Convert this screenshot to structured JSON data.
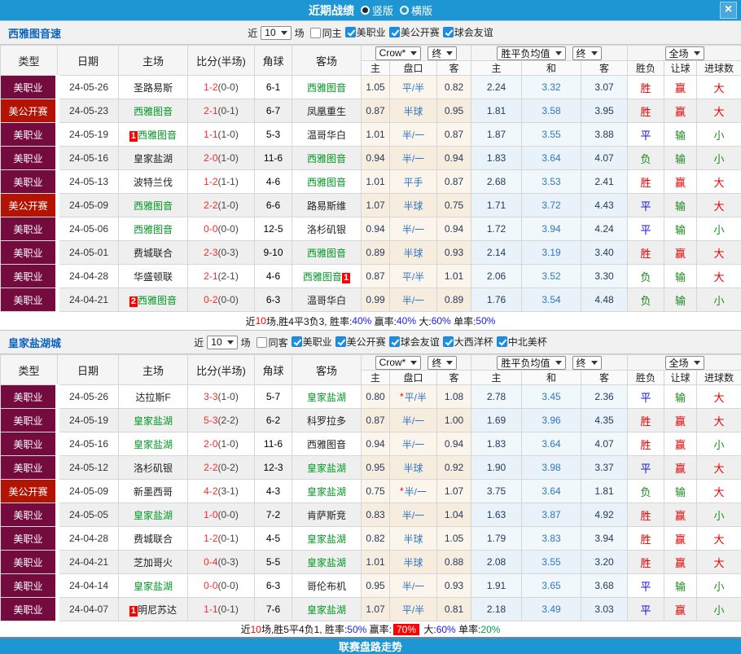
{
  "top_bar": {
    "title": "近期战绩",
    "radio_selected_label": "竖版",
    "radio_unselected_label": "横版",
    "close_glyph": "×"
  },
  "bottom_bar": {
    "label": "联赛盘路走势"
  },
  "colors": {
    "bar_blue": "#1E96D3",
    "league_mls": "#740B3F",
    "league_open_cup": "#B21303",
    "team_highlight_green": "#009922",
    "score_red": "#FF2A2A",
    "win_red": "#E60000",
    "draw_blue": "#1515D0",
    "loss_green": "#1E8A1E"
  },
  "table_header": {
    "cols": [
      "类型",
      "日期",
      "主场",
      "比分(半场)",
      "角球",
      "客场"
    ],
    "crow_select": "Crow*",
    "crow_final": "终",
    "avg_select": "胜平负均值",
    "avg_final": "终",
    "scope_select": "全场",
    "sub": [
      "主",
      "盘口",
      "客",
      "主",
      "和",
      "客",
      "胜负",
      "让球",
      "进球数"
    ]
  },
  "sections": [
    {
      "team": "西雅图音速",
      "filter": {
        "near": "近",
        "count": "10",
        "unit": "场",
        "same_label": "同主",
        "same_checked": false,
        "leagues": [
          {
            "label": "美职业",
            "checked": true
          },
          {
            "label": "美公开赛",
            "checked": true
          },
          {
            "label": "球会友谊",
            "checked": true
          }
        ]
      },
      "rows": [
        {
          "lg": "美职业",
          "lgc": "lg-mls",
          "date": "24-05-26",
          "home": "圣路易斯",
          "hg": false,
          "hb": "",
          "hbp": "",
          "score": "1-2",
          "half": "(0-0)",
          "corner": "6-1",
          "away": "西雅图音",
          "ag": true,
          "ab": "",
          "abp": "",
          "o1": "1.05",
          "hd": "平/半",
          "star": false,
          "o2": "0.82",
          "a1": "2.24",
          "a2": "3.32",
          "a3": "3.07",
          "r1": "胜",
          "r1c": "red",
          "r2": "赢",
          "r2c": "red",
          "r3": "大",
          "r3c": "red"
        },
        {
          "lg": "美公开赛",
          "lgc": "lg-open",
          "date": "24-05-23",
          "home": "西雅图音",
          "hg": true,
          "hb": "",
          "hbp": "",
          "score": "2-1",
          "half": "(0-1)",
          "corner": "6-7",
          "away": "凤凰重生",
          "ag": false,
          "ab": "",
          "abp": "",
          "o1": "0.87",
          "hd": "半球",
          "star": false,
          "o2": "0.95",
          "a1": "1.81",
          "a2": "3.58",
          "a3": "3.95",
          "r1": "胜",
          "r1c": "red",
          "r2": "赢",
          "r2c": "red",
          "r3": "大",
          "r3c": "red"
        },
        {
          "lg": "美职业",
          "lgc": "lg-mls",
          "date": "24-05-19",
          "home": "西雅图音",
          "hg": true,
          "hb": "1",
          "hbp": "before",
          "score": "1-1",
          "half": "(1-0)",
          "corner": "5-3",
          "away": "温哥华白",
          "ag": false,
          "ab": "",
          "abp": "",
          "o1": "1.01",
          "hd": "半/一",
          "star": false,
          "o2": "0.87",
          "a1": "1.87",
          "a2": "3.55",
          "a3": "3.88",
          "r1": "平",
          "r1c": "blue",
          "r2": "输",
          "r2c": "green",
          "r3": "小",
          "r3c": "green"
        },
        {
          "lg": "美职业",
          "lgc": "lg-mls",
          "date": "24-05-16",
          "home": "皇家盐湖",
          "hg": false,
          "hb": "",
          "hbp": "",
          "score": "2-0",
          "half": "(1-0)",
          "corner": "11-6",
          "away": "西雅图音",
          "ag": true,
          "ab": "",
          "abp": "",
          "o1": "0.94",
          "hd": "半/一",
          "star": false,
          "o2": "0.94",
          "a1": "1.83",
          "a2": "3.64",
          "a3": "4.07",
          "r1": "负",
          "r1c": "green",
          "r2": "输",
          "r2c": "green",
          "r3": "小",
          "r3c": "green"
        },
        {
          "lg": "美职业",
          "lgc": "lg-mls",
          "date": "24-05-13",
          "home": "波特兰伐",
          "hg": false,
          "hb": "",
          "hbp": "",
          "score": "1-2",
          "half": "(1-1)",
          "corner": "4-6",
          "away": "西雅图音",
          "ag": true,
          "ab": "",
          "abp": "",
          "o1": "1.01",
          "hd": "平手",
          "star": false,
          "o2": "0.87",
          "a1": "2.68",
          "a2": "3.53",
          "a3": "2.41",
          "r1": "胜",
          "r1c": "red",
          "r2": "赢",
          "r2c": "red",
          "r3": "大",
          "r3c": "red"
        },
        {
          "lg": "美公开赛",
          "lgc": "lg-open",
          "date": "24-05-09",
          "home": "西雅图音",
          "hg": true,
          "hb": "",
          "hbp": "",
          "score": "2-2",
          "half": "(1-0)",
          "corner": "6-6",
          "away": "路易斯维",
          "ag": false,
          "ab": "",
          "abp": "",
          "o1": "1.07",
          "hd": "半球",
          "star": false,
          "o2": "0.75",
          "a1": "1.71",
          "a2": "3.72",
          "a3": "4.43",
          "r1": "平",
          "r1c": "blue",
          "r2": "输",
          "r2c": "green",
          "r3": "大",
          "r3c": "red"
        },
        {
          "lg": "美职业",
          "lgc": "lg-mls",
          "date": "24-05-06",
          "home": "西雅图音",
          "hg": true,
          "hb": "",
          "hbp": "",
          "score": "0-0",
          "half": "(0-0)",
          "corner": "12-5",
          "away": "洛杉矶银",
          "ag": false,
          "ab": "",
          "abp": "",
          "o1": "0.94",
          "hd": "半/一",
          "star": false,
          "o2": "0.94",
          "a1": "1.72",
          "a2": "3.94",
          "a3": "4.24",
          "r1": "平",
          "r1c": "blue",
          "r2": "输",
          "r2c": "green",
          "r3": "小",
          "r3c": "green"
        },
        {
          "lg": "美职业",
          "lgc": "lg-mls",
          "date": "24-05-01",
          "home": "费城联合",
          "hg": false,
          "hb": "",
          "hbp": "",
          "score": "2-3",
          "half": "(0-3)",
          "corner": "9-10",
          "away": "西雅图音",
          "ag": true,
          "ab": "",
          "abp": "",
          "o1": "0.89",
          "hd": "半球",
          "star": false,
          "o2": "0.93",
          "a1": "2.14",
          "a2": "3.19",
          "a3": "3.40",
          "r1": "胜",
          "r1c": "red",
          "r2": "赢",
          "r2c": "red",
          "r3": "大",
          "r3c": "red"
        },
        {
          "lg": "美职业",
          "lgc": "lg-mls",
          "date": "24-04-28",
          "home": "华盛顿联",
          "hg": false,
          "hb": "",
          "hbp": "",
          "score": "2-1",
          "half": "(2-1)",
          "corner": "4-6",
          "away": "西雅图音",
          "ag": true,
          "ab": "1",
          "abp": "after",
          "o1": "0.87",
          "hd": "平/半",
          "star": false,
          "o2": "1.01",
          "a1": "2.06",
          "a2": "3.52",
          "a3": "3.30",
          "r1": "负",
          "r1c": "green",
          "r2": "输",
          "r2c": "green",
          "r3": "大",
          "r3c": "red"
        },
        {
          "lg": "美职业",
          "lgc": "lg-mls",
          "date": "24-04-21",
          "home": "西雅图音",
          "hg": true,
          "hb": "2",
          "hbp": "before",
          "score": "0-2",
          "half": "(0-0)",
          "corner": "6-3",
          "away": "温哥华白",
          "ag": false,
          "ab": "",
          "abp": "",
          "o1": "0.99",
          "hd": "半/一",
          "star": false,
          "o2": "0.89",
          "a1": "1.76",
          "a2": "3.54",
          "a3": "4.48",
          "r1": "负",
          "r1c": "green",
          "r2": "输",
          "r2c": "green",
          "r3": "小",
          "r3c": "green"
        }
      ],
      "summary": [
        {
          "t": "近",
          "c": "k"
        },
        {
          "t": "10",
          "c": "r"
        },
        {
          "t": "场,胜4平3负3, 胜率:",
          "c": "k"
        },
        {
          "t": "40%",
          "c": "b"
        },
        {
          "t": " 赢率:",
          "c": "k"
        },
        {
          "t": "40%",
          "c": "b"
        },
        {
          "t": " 大:",
          "c": "k"
        },
        {
          "t": "60%",
          "c": "b"
        },
        {
          "t": " 单率:",
          "c": "k"
        },
        {
          "t": "50%",
          "c": "b"
        }
      ]
    },
    {
      "team": "皇家盐湖城",
      "filter": {
        "near": "近",
        "count": "10",
        "unit": "场",
        "same_label": "同客",
        "same_checked": false,
        "leagues": [
          {
            "label": "美职业",
            "checked": true
          },
          {
            "label": "美公开赛",
            "checked": true
          },
          {
            "label": "球会友谊",
            "checked": true
          },
          {
            "label": "大西洋杯",
            "checked": true
          },
          {
            "label": "中北美杯",
            "checked": true
          }
        ]
      },
      "rows": [
        {
          "lg": "美职业",
          "lgc": "lg-mls",
          "date": "24-05-26",
          "home": "达拉斯F",
          "hg": false,
          "hb": "",
          "hbp": "",
          "score": "3-3",
          "half": "(1-0)",
          "corner": "5-7",
          "away": "皇家盐湖",
          "ag": true,
          "ab": "",
          "abp": "",
          "o1": "0.80",
          "hd": "平/半",
          "star": true,
          "o2": "1.08",
          "a1": "2.78",
          "a2": "3.45",
          "a3": "2.36",
          "r1": "平",
          "r1c": "blue",
          "r2": "输",
          "r2c": "green",
          "r3": "大",
          "r3c": "red"
        },
        {
          "lg": "美职业",
          "lgc": "lg-mls",
          "date": "24-05-19",
          "home": "皇家盐湖",
          "hg": true,
          "hb": "",
          "hbp": "",
          "score": "5-3",
          "half": "(2-2)",
          "corner": "6-2",
          "away": "科罗拉多",
          "ag": false,
          "ab": "",
          "abp": "",
          "o1": "0.87",
          "hd": "半/一",
          "star": false,
          "o2": "1.00",
          "a1": "1.69",
          "a2": "3.96",
          "a3": "4.35",
          "r1": "胜",
          "r1c": "red",
          "r2": "赢",
          "r2c": "red",
          "r3": "大",
          "r3c": "red"
        },
        {
          "lg": "美职业",
          "lgc": "lg-mls",
          "date": "24-05-16",
          "home": "皇家盐湖",
          "hg": true,
          "hb": "",
          "hbp": "",
          "score": "2-0",
          "half": "(1-0)",
          "corner": "11-6",
          "away": "西雅图音",
          "ag": false,
          "ab": "",
          "abp": "",
          "o1": "0.94",
          "hd": "半/一",
          "star": false,
          "o2": "0.94",
          "a1": "1.83",
          "a2": "3.64",
          "a3": "4.07",
          "r1": "胜",
          "r1c": "red",
          "r2": "赢",
          "r2c": "red",
          "r3": "小",
          "r3c": "green"
        },
        {
          "lg": "美职业",
          "lgc": "lg-mls",
          "date": "24-05-12",
          "home": "洛杉矶银",
          "hg": false,
          "hb": "",
          "hbp": "",
          "score": "2-2",
          "half": "(0-2)",
          "corner": "12-3",
          "away": "皇家盐湖",
          "ag": true,
          "ab": "",
          "abp": "",
          "o1": "0.95",
          "hd": "半球",
          "star": false,
          "o2": "0.92",
          "a1": "1.90",
          "a2": "3.98",
          "a3": "3.37",
          "r1": "平",
          "r1c": "blue",
          "r2": "赢",
          "r2c": "red",
          "r3": "大",
          "r3c": "red"
        },
        {
          "lg": "美公开赛",
          "lgc": "lg-open",
          "date": "24-05-09",
          "home": "新墨西哥",
          "hg": false,
          "hb": "",
          "hbp": "",
          "score": "4-2",
          "half": "(3-1)",
          "corner": "4-3",
          "away": "皇家盐湖",
          "ag": true,
          "ab": "",
          "abp": "",
          "o1": "0.75",
          "hd": "半/一",
          "star": true,
          "o2": "1.07",
          "a1": "3.75",
          "a2": "3.64",
          "a3": "1.81",
          "r1": "负",
          "r1c": "green",
          "r2": "输",
          "r2c": "green",
          "r3": "大",
          "r3c": "red"
        },
        {
          "lg": "美职业",
          "lgc": "lg-mls",
          "date": "24-05-05",
          "home": "皇家盐湖",
          "hg": true,
          "hb": "",
          "hbp": "",
          "score": "1-0",
          "half": "(0-0)",
          "corner": "7-2",
          "away": "肯萨斯竞",
          "ag": false,
          "ab": "",
          "abp": "",
          "o1": "0.83",
          "hd": "半/一",
          "star": false,
          "o2": "1.04",
          "a1": "1.63",
          "a2": "3.87",
          "a3": "4.92",
          "r1": "胜",
          "r1c": "red",
          "r2": "赢",
          "r2c": "red",
          "r3": "小",
          "r3c": "green"
        },
        {
          "lg": "美职业",
          "lgc": "lg-mls",
          "date": "24-04-28",
          "home": "费城联合",
          "hg": false,
          "hb": "",
          "hbp": "",
          "score": "1-2",
          "half": "(0-1)",
          "corner": "4-5",
          "away": "皇家盐湖",
          "ag": true,
          "ab": "",
          "abp": "",
          "o1": "0.82",
          "hd": "半球",
          "star": false,
          "o2": "1.05",
          "a1": "1.79",
          "a2": "3.83",
          "a3": "3.94",
          "r1": "胜",
          "r1c": "red",
          "r2": "赢",
          "r2c": "red",
          "r3": "大",
          "r3c": "red"
        },
        {
          "lg": "美职业",
          "lgc": "lg-mls",
          "date": "24-04-21",
          "home": "芝加哥火",
          "hg": false,
          "hb": "",
          "hbp": "",
          "score": "0-4",
          "half": "(0-3)",
          "corner": "5-5",
          "away": "皇家盐湖",
          "ag": true,
          "ab": "",
          "abp": "",
          "o1": "1.01",
          "hd": "半球",
          "star": false,
          "o2": "0.88",
          "a1": "2.08",
          "a2": "3.55",
          "a3": "3.20",
          "r1": "胜",
          "r1c": "red",
          "r2": "赢",
          "r2c": "red",
          "r3": "大",
          "r3c": "red"
        },
        {
          "lg": "美职业",
          "lgc": "lg-mls",
          "date": "24-04-14",
          "home": "皇家盐湖",
          "hg": true,
          "hb": "",
          "hbp": "",
          "score": "0-0",
          "half": "(0-0)",
          "corner": "6-3",
          "away": "哥伦布机",
          "ag": false,
          "ab": "",
          "abp": "",
          "o1": "0.95",
          "hd": "半/一",
          "star": false,
          "o2": "0.93",
          "a1": "1.91",
          "a2": "3.65",
          "a3": "3.68",
          "r1": "平",
          "r1c": "blue",
          "r2": "输",
          "r2c": "green",
          "r3": "小",
          "r3c": "green"
        },
        {
          "lg": "美职业",
          "lgc": "lg-mls",
          "date": "24-04-07",
          "home": "明尼苏达",
          "hg": false,
          "hb": "1",
          "hbp": "before",
          "score": "1-1",
          "half": "(0-1)",
          "corner": "7-6",
          "away": "皇家盐湖",
          "ag": true,
          "ab": "",
          "abp": "",
          "o1": "1.07",
          "hd": "平/半",
          "star": false,
          "o2": "0.81",
          "a1": "2.18",
          "a2": "3.49",
          "a3": "3.03",
          "r1": "平",
          "r1c": "blue",
          "r2": "赢",
          "r2c": "red",
          "r3": "小",
          "r3c": "green"
        }
      ],
      "summary": [
        {
          "t": "近",
          "c": "k"
        },
        {
          "t": "10",
          "c": "r"
        },
        {
          "t": "场,胜5平4负1, 胜率:",
          "c": "k"
        },
        {
          "t": "50%",
          "c": "b"
        },
        {
          "t": " 赢率:",
          "c": "k"
        },
        {
          "t": "70%",
          "c": "hl"
        },
        {
          "t": " 大:",
          "c": "k"
        },
        {
          "t": "60%",
          "c": "b"
        },
        {
          "t": " 单率:",
          "c": "k"
        },
        {
          "t": "20%",
          "c": "g"
        }
      ]
    }
  ]
}
